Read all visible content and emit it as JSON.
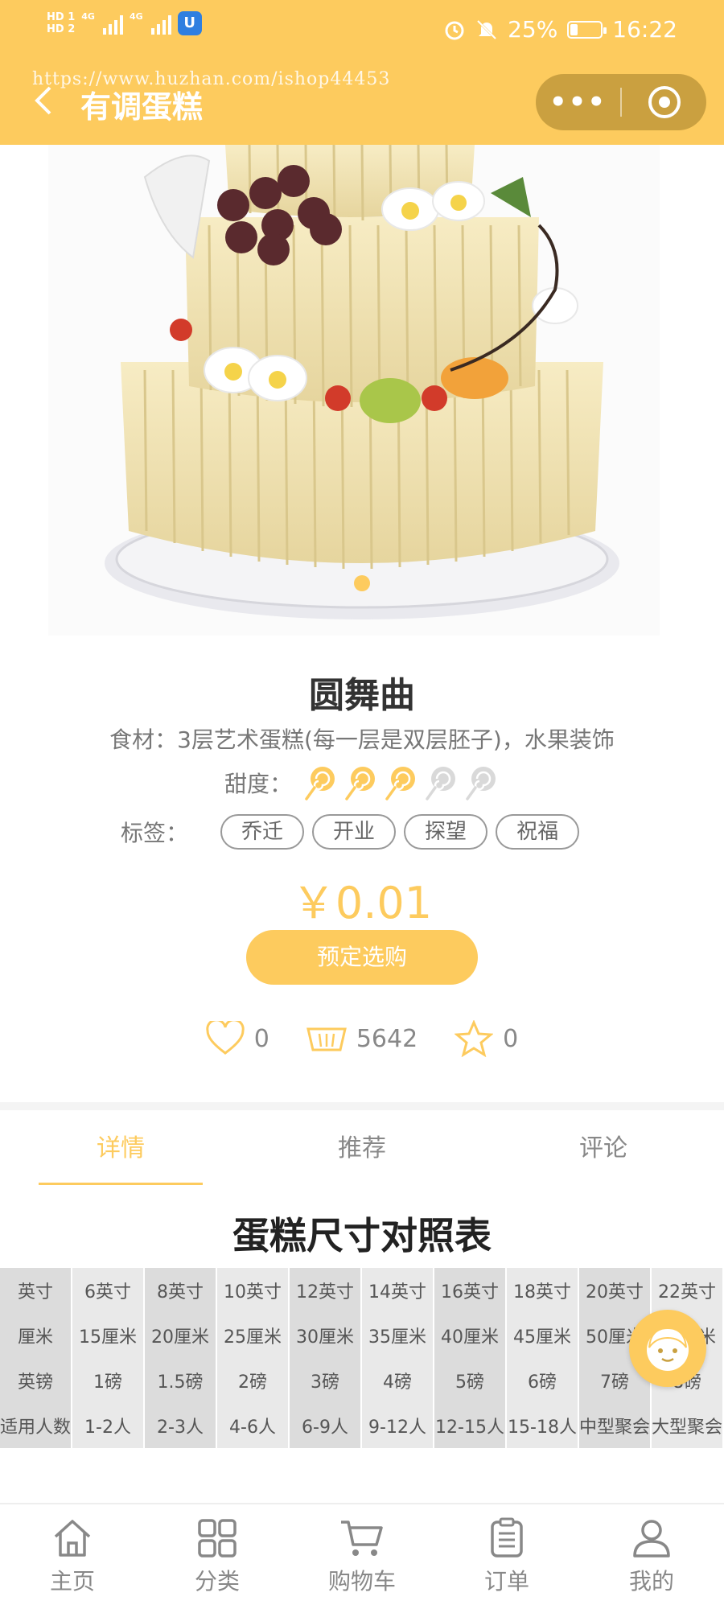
{
  "status_bar": {
    "sim_labels": [
      "HD 1",
      "HD 2"
    ],
    "network": "4G",
    "battery": "25%",
    "battery_level": 0.25,
    "time": "16:22"
  },
  "header": {
    "title": "有调蛋糕",
    "watermark": "https://www.huzhan.com/ishop44453",
    "more_icon": "more-dots-icon",
    "capsule_icon": "target-circle-icon"
  },
  "product": {
    "name": "圆舞曲",
    "ingredients": "食材：3层艺术蛋糕(每一层是双层胚子)，水果装饰",
    "sweetness_label": "甜度：",
    "sweetness_level": 3,
    "sweetness_max": 5,
    "tags_label": "标签：",
    "tags": [
      "乔迁",
      "开业",
      "探望",
      "祝福"
    ],
    "price": "￥0.01",
    "reserve_label": "预定选购"
  },
  "stats": {
    "likes": "0",
    "sales": "5642",
    "favorites": "0"
  },
  "tabs": [
    {
      "label": "详情",
      "active": true
    },
    {
      "label": "推荐",
      "active": false
    },
    {
      "label": "评论",
      "active": false
    }
  ],
  "size_table": {
    "title": "蛋糕尺寸对照表",
    "rows": [
      [
        "英寸",
        "6英寸",
        "8英寸",
        "10英寸",
        "12英寸",
        "14英寸",
        "16英寸",
        "18英寸",
        "20英寸",
        "22英寸"
      ],
      [
        "厘米",
        "15厘米",
        "20厘米",
        "25厘米",
        "30厘米",
        "35厘米",
        "40厘米",
        "45厘米",
        "50厘米",
        "55厘米"
      ],
      [
        "英镑",
        "1磅",
        "1.5磅",
        "2磅",
        "3磅",
        "4磅",
        "5磅",
        "6磅",
        "7磅",
        "8磅"
      ],
      [
        "适用人数",
        "1-2人",
        "2-3人",
        "4-6人",
        "6-9人",
        "9-12人",
        "12-15人",
        "15-18人",
        "中型聚会",
        "大型聚会"
      ]
    ]
  },
  "bottom_nav": [
    {
      "label": "主页",
      "icon": "home-icon"
    },
    {
      "label": "分类",
      "icon": "category-grid-icon"
    },
    {
      "label": "购物车",
      "icon": "cart-icon"
    },
    {
      "label": "订单",
      "icon": "order-list-icon"
    },
    {
      "label": "我的",
      "icon": "user-icon"
    }
  ],
  "colors": {
    "accent": "#FDCB5E",
    "text_muted": "#888888"
  }
}
